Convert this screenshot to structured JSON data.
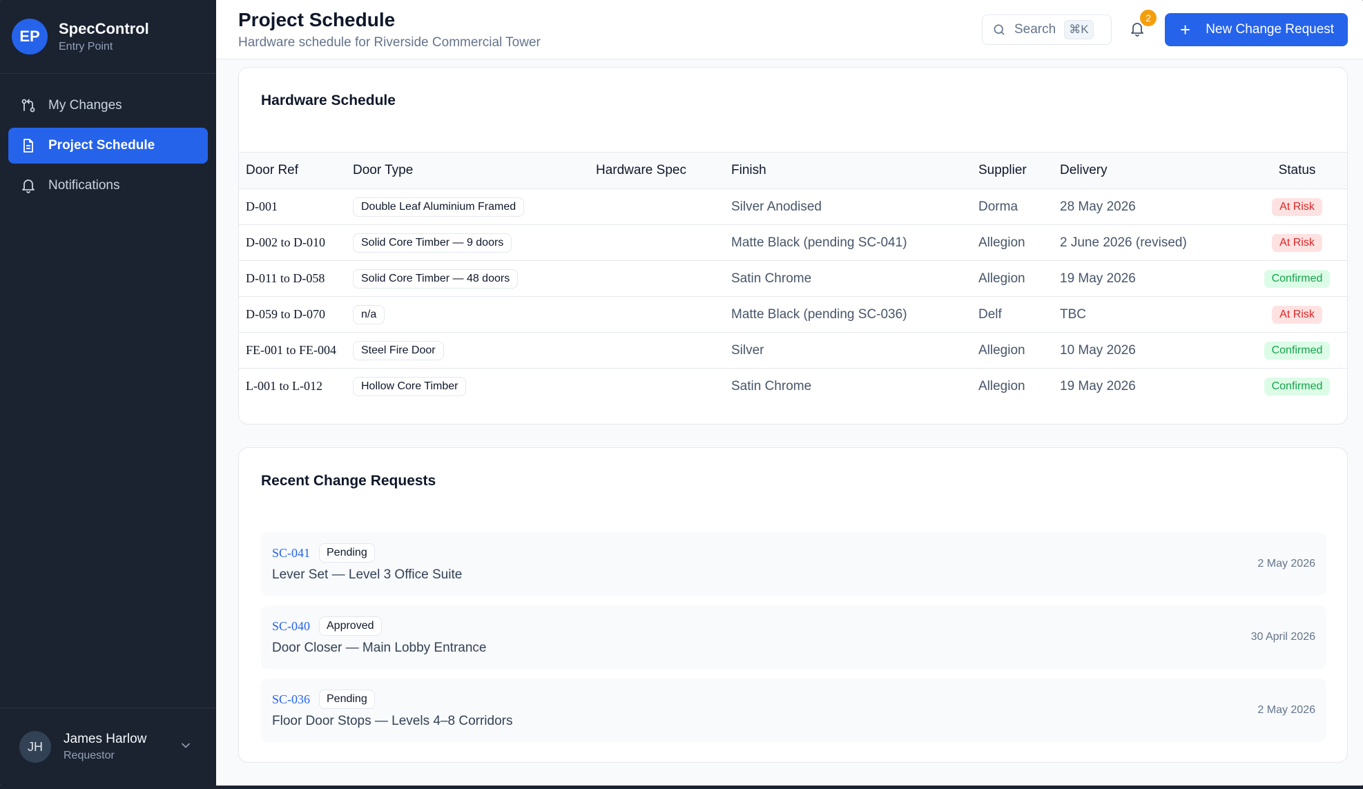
{
  "brand": {
    "initials": "EP",
    "name": "SpecControl",
    "subtitle": "Entry Point"
  },
  "sidebar": {
    "items": [
      {
        "label": "My Changes",
        "icon": "git-compare-icon",
        "active": false
      },
      {
        "label": "Project Schedule",
        "icon": "document-icon",
        "active": true
      },
      {
        "label": "Notifications",
        "icon": "bell-icon",
        "active": false
      }
    ]
  },
  "user": {
    "initials": "JH",
    "name": "James Harlow",
    "role": "Requestor"
  },
  "header": {
    "title": "Project Schedule",
    "subtitle": "Hardware schedule for Riverside Commercial Tower",
    "search_label": "Search",
    "search_shortcut": "⌘K",
    "notification_count": "2",
    "new_request_label": "New Change Request"
  },
  "schedule": {
    "title": "Hardware Schedule",
    "columns": [
      "Door Ref",
      "Door Type",
      "Hardware Spec",
      "Finish",
      "Supplier",
      "Delivery",
      "Status"
    ],
    "rows": [
      {
        "ref": "D-001",
        "type": "Double Leaf Aluminium Framed",
        "spec": "",
        "finish": "Silver Anodised",
        "supplier": "Dorma",
        "delivery": "28 May 2026",
        "status": "At Risk"
      },
      {
        "ref": "D-002 to D-010",
        "type": "Solid Core Timber — 9 doors",
        "spec": "",
        "finish": "Matte Black (pending SC-041)",
        "supplier": "Allegion",
        "delivery": "2 June 2026 (revised)",
        "status": "At Risk"
      },
      {
        "ref": "D-011 to D-058",
        "type": "Solid Core Timber — 48 doors",
        "spec": "",
        "finish": "Satin Chrome",
        "supplier": "Allegion",
        "delivery": "19 May 2026",
        "status": "Confirmed"
      },
      {
        "ref": "D-059 to D-070",
        "type": "n/a",
        "spec": "",
        "finish": "Matte Black (pending SC-036)",
        "supplier": "Delf",
        "delivery": "TBC",
        "status": "At Risk"
      },
      {
        "ref": "FE-001 to FE-004",
        "type": "Steel Fire Door",
        "spec": "",
        "finish": "Silver",
        "supplier": "Allegion",
        "delivery": "10 May 2026",
        "status": "Confirmed"
      },
      {
        "ref": "L-001 to L-012",
        "type": "Hollow Core Timber",
        "spec": "",
        "finish": "Satin Chrome",
        "supplier": "Allegion",
        "delivery": "19 May 2026",
        "status": "Confirmed"
      }
    ]
  },
  "changes": {
    "title": "Recent Change Requests",
    "items": [
      {
        "id": "SC-041",
        "status": "Pending",
        "title": "Lever Set — Level 3 Office Suite",
        "date": "2 May 2026"
      },
      {
        "id": "SC-040",
        "status": "Approved",
        "title": "Door Closer — Main Lobby Entrance",
        "date": "30 April 2026"
      },
      {
        "id": "SC-036",
        "status": "Pending",
        "title": "Floor Door Stops — Levels 4–8 Corridors",
        "date": "2 May 2026"
      }
    ]
  },
  "colors": {
    "accent": "#2563eb",
    "sidebar": "#1b2230",
    "risk": "#dc2626",
    "confirmed": "#16a34a",
    "notification": "#f59e0b"
  }
}
